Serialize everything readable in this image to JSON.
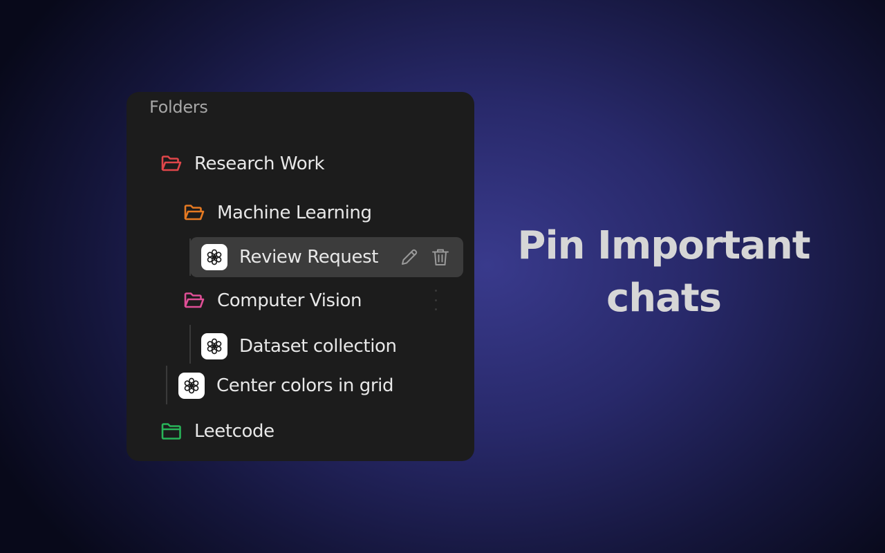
{
  "panel": {
    "title": "Folders",
    "items": [
      {
        "type": "folder",
        "label": "Research Work",
        "icon": "folder-open-icon",
        "color": "#e0464a"
      },
      {
        "type": "folder",
        "label": "Machine Learning",
        "icon": "folder-open-icon",
        "color": "#e67a22"
      },
      {
        "type": "chat",
        "label": "Review Request",
        "icon": "openai-logo-icon",
        "selected": true
      },
      {
        "type": "folder",
        "label": "Computer Vision",
        "icon": "folder-open-icon",
        "color": "#e04f97"
      },
      {
        "type": "chat",
        "label": "Dataset collection",
        "icon": "openai-logo-icon"
      },
      {
        "type": "chat",
        "label": "Center colors in grid",
        "icon": "openai-logo-icon"
      },
      {
        "type": "folder",
        "label": "Leetcode",
        "icon": "folder-icon",
        "color": "#28b559"
      }
    ],
    "selected_actions": [
      "pencil-icon",
      "trash-icon"
    ],
    "more_icon": "more-vertical-icon"
  },
  "headline": {
    "line1": "Pin Important",
    "line2": "chats"
  }
}
